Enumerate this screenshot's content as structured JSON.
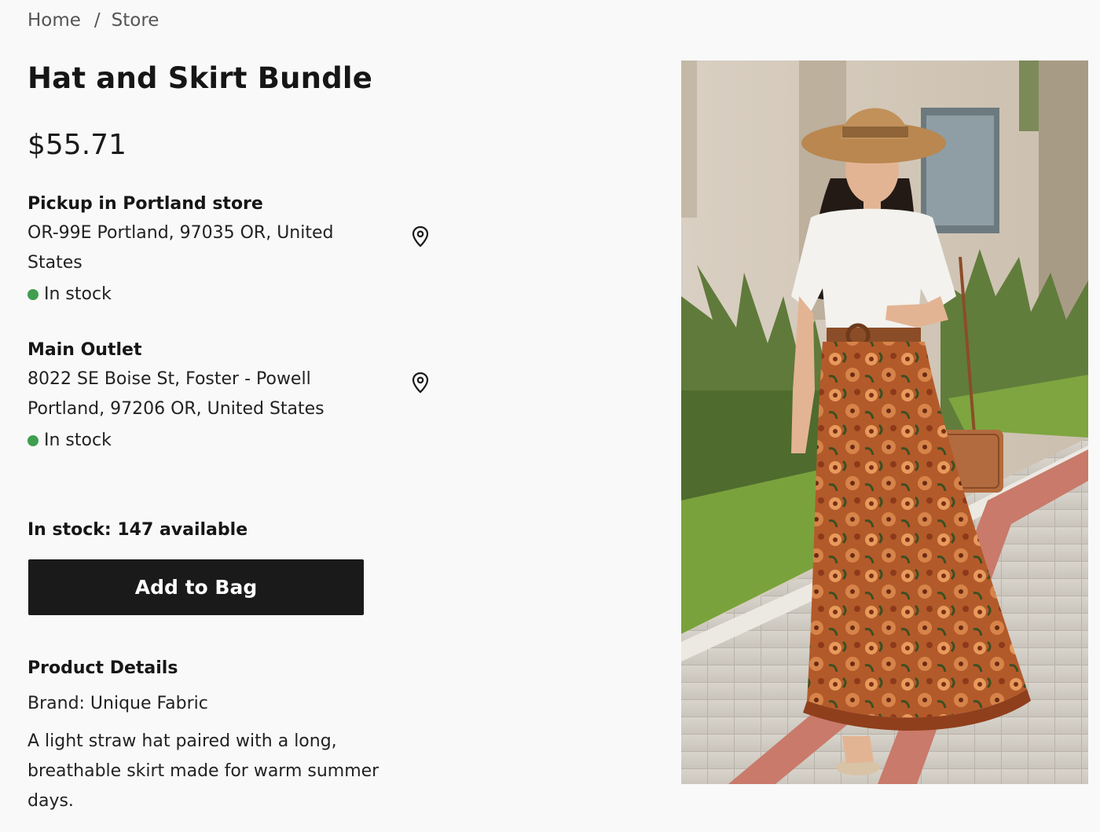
{
  "breadcrumb": {
    "home": "Home",
    "separator": "/",
    "current": "Store"
  },
  "product": {
    "title": "Hat and Skirt Bundle",
    "price": "$55.71",
    "image_alt": "Woman wearing a straw hat, white blouse and long floral skirt"
  },
  "stores": [
    {
      "name": "Pickup in Portland store",
      "address": "OR-99E Portland, 97035 OR, United States",
      "stock": "In stock",
      "pin_icon": "map-pin-icon"
    },
    {
      "name": "Main Outlet",
      "address": "8022 SE Boise St, Foster - Powell Portland, 97206 OR, United States",
      "stock": "In stock",
      "pin_icon": "map-pin-icon"
    }
  ],
  "inventory": {
    "available_text": "In stock: 147 available"
  },
  "actions": {
    "add_to_bag": "Add to Bag"
  },
  "details": {
    "heading": "Product Details",
    "brand": "Brand: Unique Fabric",
    "description": "A light straw hat paired with a long, breathable skirt made for warm summer days."
  },
  "colors": {
    "background": "#f9f9f9",
    "button": "#1a1a1a",
    "button_text": "#ffffff",
    "in_stock_dot": "#3f9e4f"
  }
}
